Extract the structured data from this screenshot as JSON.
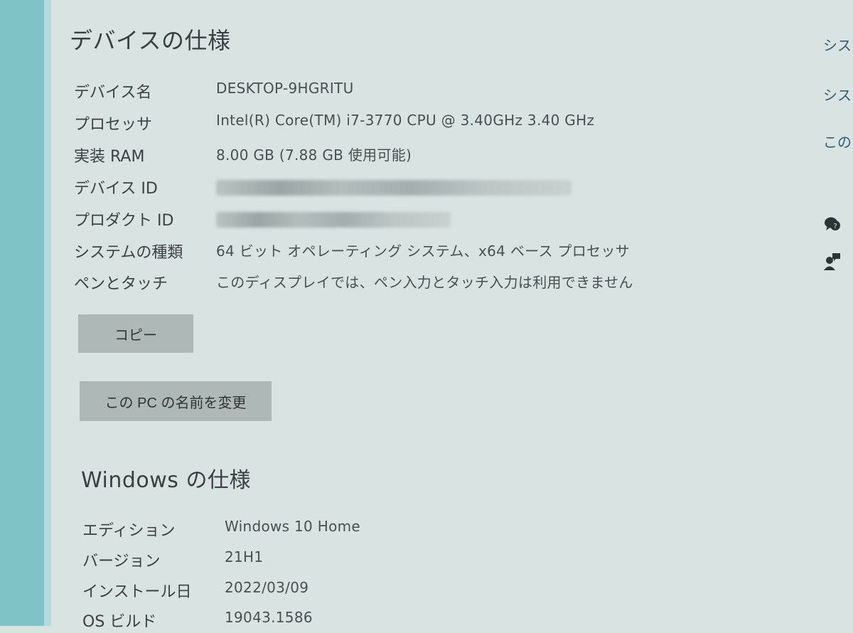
{
  "device_spec": {
    "title": "デバイスの仕様",
    "rows": [
      {
        "label": "デバイス名",
        "value": "DESKTOP-9HGRITU"
      },
      {
        "label": "プロセッサ",
        "value": "Intel(R) Core(TM) i7-3770 CPU @ 3.40GHz   3.40 GHz"
      },
      {
        "label": "実装 RAM",
        "value": "8.00 GB (7.88 GB 使用可能)"
      },
      {
        "label": "デバイス ID",
        "value": ""
      },
      {
        "label": "プロダクト ID",
        "value": ""
      },
      {
        "label": "システムの種類",
        "value": "64 ビット オペレーティング システム、x64 ベース プロセッサ"
      },
      {
        "label": "ペンとタッチ",
        "value": "このディスプレイでは、ペン入力とタッチ入力は利用できません"
      }
    ],
    "copy_button": "コピー",
    "rename_button": "この PC の名前を変更"
  },
  "windows_spec": {
    "title": "Windows の仕様",
    "rows": [
      {
        "label": "エディション",
        "value": "Windows 10 Home"
      },
      {
        "label": "バージョン",
        "value": "21H1"
      },
      {
        "label": "インストール日",
        "value": "2022/03/09"
      },
      {
        "label": "OS ビルド",
        "value": "19043.1586"
      }
    ]
  },
  "right_links": {
    "items": [
      "シス",
      "シス",
      "この"
    ]
  },
  "colors": {
    "background": "#d9e3e1",
    "left_accent": "#7fc3c6",
    "button": "#aeb8b7",
    "link": "#2f5f78"
  }
}
